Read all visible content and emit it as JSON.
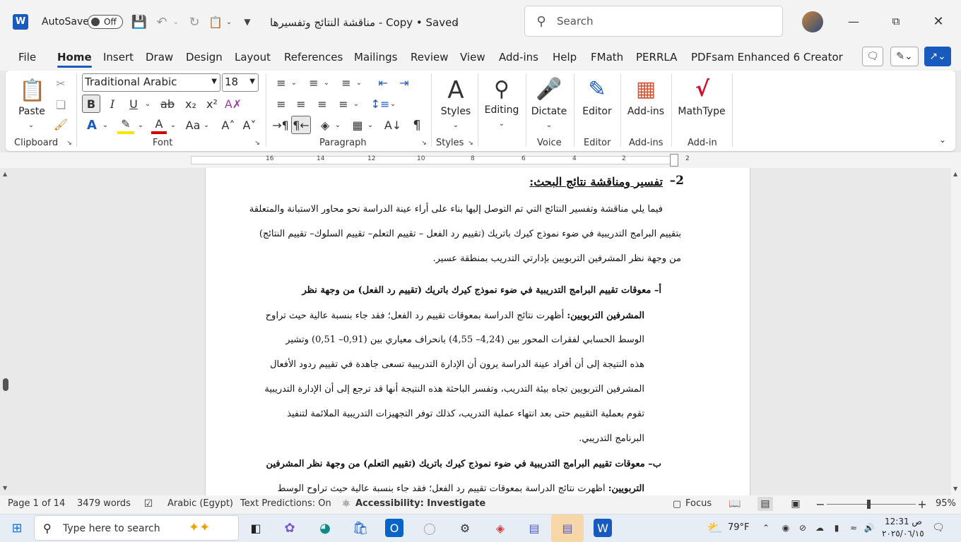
{
  "window": {
    "autosave_label": "AutoSave",
    "autosave_state": "Off",
    "doc_title": "مناقشة النتائج وتفسيرها - Copy • Saved",
    "search_placeholder": "Search"
  },
  "tabs": [
    "File",
    "Home",
    "Insert",
    "Draw",
    "Design",
    "Layout",
    "References",
    "Mailings",
    "Review",
    "View",
    "Add-ins",
    "Help",
    "FMath",
    "PERRLA",
    "PDFsam Enhanced 6 Creator"
  ],
  "ribbon": {
    "clipboard": {
      "paste": "Paste",
      "label": "Clipboard"
    },
    "font": {
      "name": "Traditional Arabic",
      "size": "18",
      "label": "Font",
      "bold": "B",
      "italic": "I",
      "underline": "U",
      "strike": "ab",
      "sub": "x₂",
      "sup": "x²",
      "case": "Aa"
    },
    "paragraph": {
      "label": "Paragraph"
    },
    "styles": {
      "button": "Styles",
      "label": "Styles"
    },
    "editing": {
      "button": "Editing"
    },
    "voice": {
      "button": "Dictate",
      "label": "Voice"
    },
    "editor": {
      "button": "Editor",
      "label": "Editor"
    },
    "addins": {
      "button": "Add-ins",
      "label": "Add-ins"
    },
    "mathtype": {
      "button": "MathType",
      "label": "Add-in"
    }
  },
  "ruler": {
    "ticks": [
      "16",
      "14",
      "12",
      "10",
      "8",
      "6",
      "4",
      "2",
      "2"
    ]
  },
  "document": {
    "heading_number": "2–",
    "heading": "تفسير ومناقشة نتائج البحث:",
    "intro_lines": [
      "فيما يلي مناقشة وتفسير النتائج التي تم التوصل إليها بناء على أراء عينة الدراسة نحو محاور الاستبانة والمتعلقة",
      "بتقييم البرامج التدريبية في ضوء نموذج كيرك باتريك (تقييم رد الفعل – تقييم التعلم– تقييم السلوك– تقييم النتائج)",
      "من وجهة نظر المشرفين التربويين بإدارتي التدريب بمنطقة عسير."
    ],
    "section_a_title_1": "أ– معوقات تقييم البرامج التدريبية في ضوء نموذج كيرك باتريك (تقييم رد الفعل) من وجهة نظر",
    "section_a_title_2": "المشرفين التربويين:",
    "section_a_line_1_rest": " أظهرت نتائج الدراسة بمعوقات تقييم رد الفعل؛ فقد جاء بنسبة عالية حيث تراوح",
    "section_a_lines": [
      "الوسط الحسابي لفقرات المحور بين (4,24– 4,55) بانحراف معياري بين (0,91– 0,51) وتشير",
      "هذه النتيجة إلى أن أفراد عينة الدراسة يرون أن الإدارة التدريبية تسعى جاهدة في تقييم ردود الأفعال",
      "المشرفين التربويين تجاه بيئة التدريب، وتفسر الباحثة هذه النتيجة أنها قد ترجع إلى أن الإدارة التدريبية",
      "تقوم بعملية التقييم حتى بعد انتهاء عملية التدريب، كذلك توفر التجهيزات التدريبية الملائمة لتنفيذ",
      "البرنامج التدريبي."
    ],
    "section_b_title_1": "ب– معوقات تقييم البرامج التدريبية في ضوء نموذج كيرك باتريك (تقييم التعلم) من وجهة نظر المشرفين",
    "section_b_title_2": "التربويين:",
    "section_b_line_1_rest": " أظهرت نتائج الدراسة بمعوقات تقييم رد الفعل؛ فقد جاء بنسبة عالية حيث تراوح الوسط"
  },
  "status": {
    "page": "Page 1 of 14",
    "words": "3479 words",
    "language": "Arabic (Egypt)",
    "predictions": "Text Predictions: On",
    "accessibility": "Accessibility: Investigate",
    "focus": "Focus",
    "zoom": "95%"
  },
  "taskbar": {
    "search_placeholder": "Type here to search",
    "temperature": "79°F",
    "time": "12:31 ص",
    "date": "٢٠٢٥/٠٦/١٥"
  }
}
